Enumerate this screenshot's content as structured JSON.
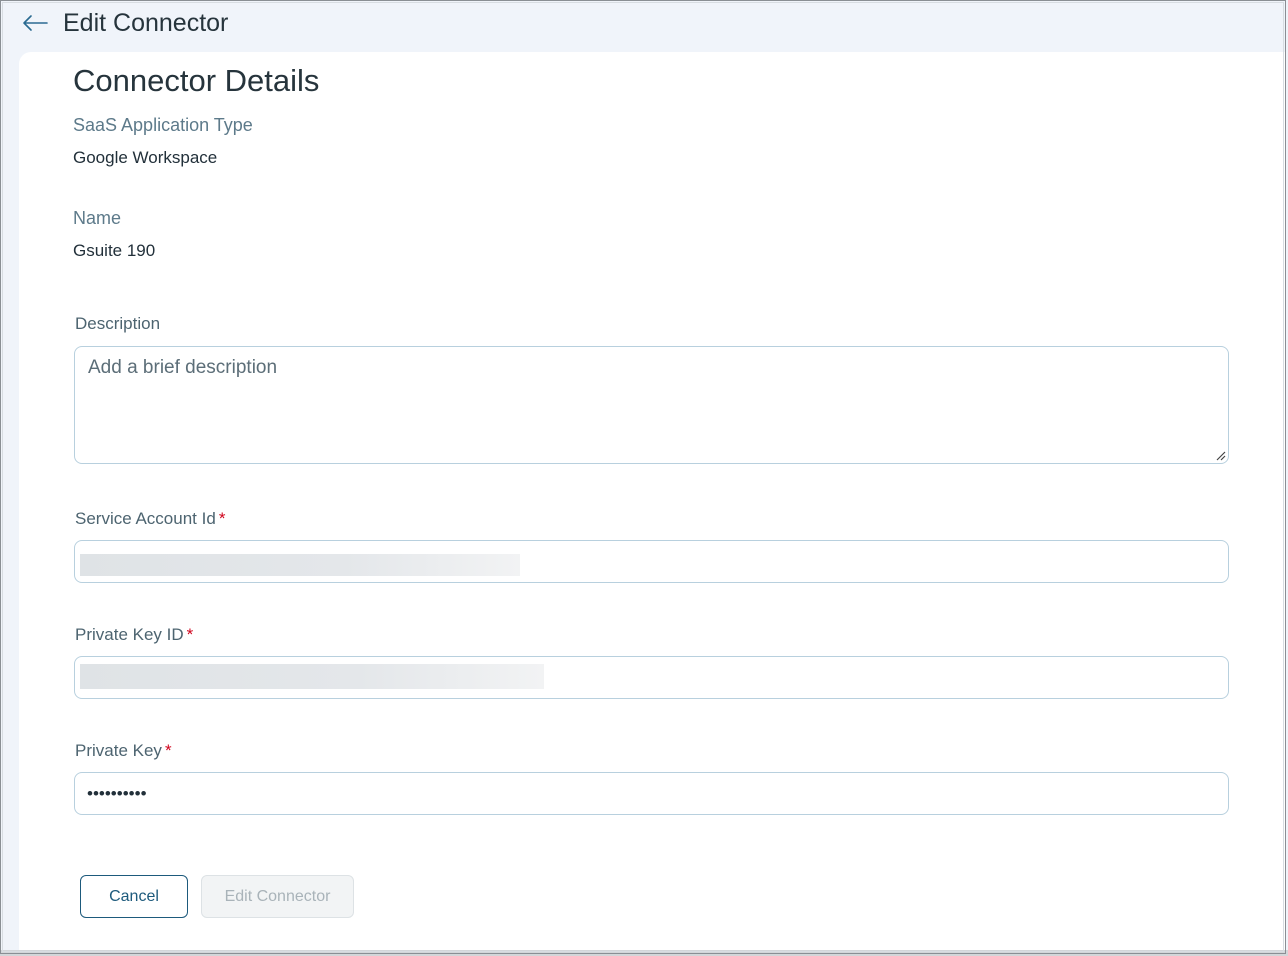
{
  "header": {
    "title": "Edit Connector",
    "back_icon": "arrow-left-icon"
  },
  "section": {
    "title": "Connector Details"
  },
  "details": {
    "app_type_label": "SaaS Application Type",
    "app_type_value": "Google Workspace",
    "name_label": "Name",
    "name_value": "Gsuite 190"
  },
  "form": {
    "description": {
      "label": "Description",
      "placeholder": "Add a brief description",
      "value": ""
    },
    "service_account_id": {
      "label": "Service Account Id",
      "required_mark": "*"
    },
    "private_key_id": {
      "label": "Private Key ID",
      "required_mark": "*"
    },
    "private_key": {
      "label": "Private Key",
      "required_mark": "*",
      "masked_value": "••••••••••"
    }
  },
  "actions": {
    "cancel_label": "Cancel",
    "submit_label": "Edit Connector"
  },
  "colors": {
    "accent": "#1d5a7c",
    "required": "#d0021b",
    "page_bg": "#f0f4fa",
    "input_border": "#b8d0de"
  }
}
